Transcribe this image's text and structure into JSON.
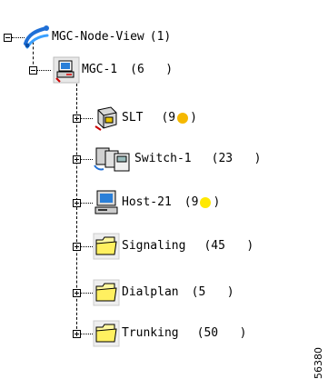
{
  "root": {
    "label": "MGC-Node-View",
    "count": "(1)"
  },
  "mgc": {
    "label": "MGC-1",
    "count": "(6   )"
  },
  "children": [
    {
      "name": "slt",
      "label": "SLT",
      "count_open": "(9",
      "count_close": ")",
      "status_color": "#f5b800"
    },
    {
      "name": "switch-1",
      "label": "Switch-1",
      "count": "(23   )"
    },
    {
      "name": "host-21",
      "label": "Host-21",
      "count_open": "(9",
      "count_close": ")",
      "status_color": "#ffe800"
    },
    {
      "name": "signaling",
      "label": "Signaling",
      "count": "(45   )"
    },
    {
      "name": "dialplan",
      "label": "Dialplan",
      "count": "(5   )"
    },
    {
      "name": "trunking",
      "label": "Trunking",
      "count": "(50   )"
    }
  ],
  "figure_id": "56380",
  "icons": {
    "root": "network-view-icon",
    "mgc": "mgc-node-icon",
    "slt": "slt-device-icon",
    "switch": "switch-icon",
    "host": "host-computer-icon",
    "folder": "folder-icon"
  }
}
